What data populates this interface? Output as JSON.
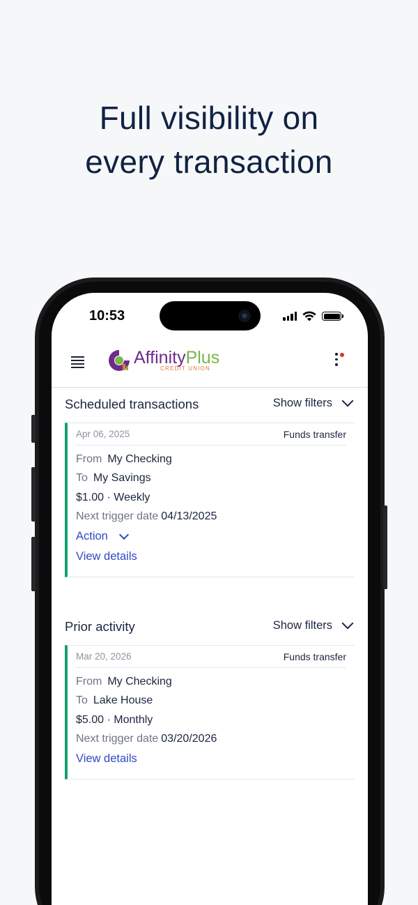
{
  "headline": {
    "line1": "Full visibility on",
    "line2": "every transaction"
  },
  "status_bar": {
    "time": "10:53"
  },
  "header": {
    "logo_main": "Affinity",
    "logo_accent": "Plus",
    "logo_sub": "CREDIT UNION"
  },
  "scheduled": {
    "title": "Scheduled transactions",
    "filters_label": "Show filters",
    "card": {
      "date": "Apr 06, 2025",
      "type": "Funds transfer",
      "from_label": "From",
      "from_value": "My Checking",
      "to_label": "To",
      "to_value": "My Savings",
      "amount_freq": "$1.00 · Weekly",
      "next_label": "Next trigger date",
      "next_value": "04/13/2025",
      "action_label": "Action",
      "details_label": "View details"
    }
  },
  "prior": {
    "title": "Prior activity",
    "filters_label": "Show filters",
    "card": {
      "date": "Mar 20, 2026",
      "type": "Funds transfer",
      "from_label": "From",
      "from_value": "My Checking",
      "to_label": "To",
      "to_value": "Lake House",
      "amount_freq": "$5.00 · Monthly",
      "next_label": "Next trigger date",
      "next_value": "03/20/2026",
      "details_label": "View details"
    }
  },
  "colors": {
    "accent_green": "#13a06f",
    "link_blue": "#2f49c4",
    "brand_purple": "#6e2b8b",
    "brand_green": "#7ab648",
    "notification_red": "#e0312a"
  }
}
